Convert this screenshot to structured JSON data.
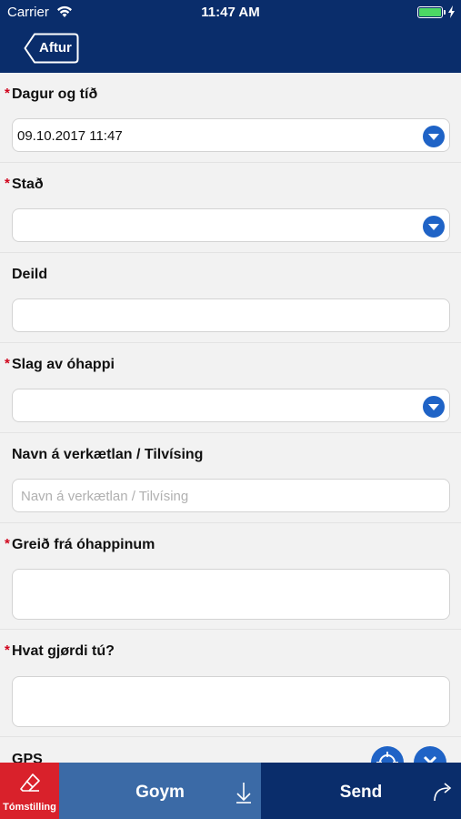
{
  "status_bar": {
    "carrier": "Carrier",
    "time": "11:47 AM"
  },
  "nav": {
    "back_label": "Aftur"
  },
  "form": {
    "date_time": {
      "label": "Dagur og tíð",
      "value": "09.10.2017 11:47",
      "required": true
    },
    "place": {
      "label": "Stað",
      "value": "",
      "required": true
    },
    "department": {
      "label": "Deild",
      "value": "",
      "required": false
    },
    "incident_type": {
      "label": "Slag av óhappi",
      "value": "",
      "required": true
    },
    "project_name": {
      "label": "Navn á verkætlan / Tilvísing",
      "placeholder": "Navn á verkætlan / Tilvísing",
      "required": false
    },
    "description": {
      "label": "Greið frá óhappinum",
      "value": "",
      "required": true
    },
    "action": {
      "label": "Hvat gjørdi tú?",
      "value": "",
      "required": true
    },
    "gps": {
      "label": "GPS"
    }
  },
  "toolbar": {
    "reset_label": "Tómstilling",
    "save_label": "Goym",
    "send_label": "Send"
  },
  "colors": {
    "header": "#0a2d6b",
    "required_mark": "#d0021b",
    "accent_blue": "#1f63c6",
    "reset": "#d9212b",
    "save": "#3b6aa6"
  }
}
